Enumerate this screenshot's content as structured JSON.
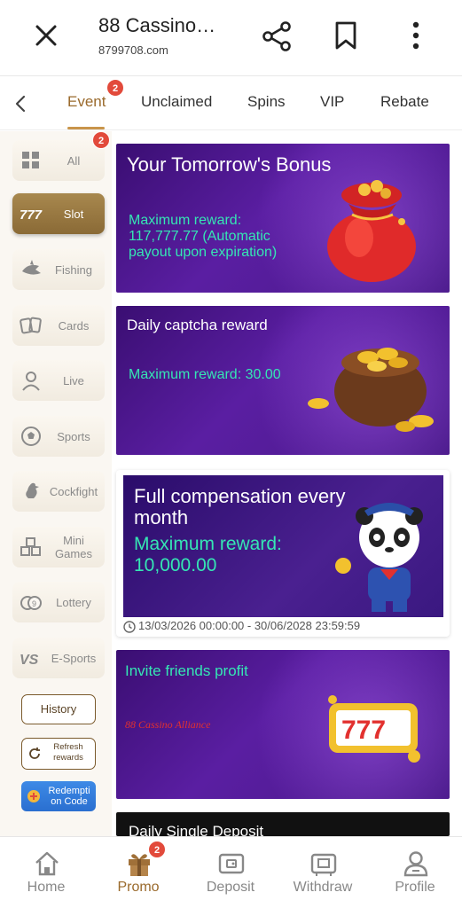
{
  "browser": {
    "title": "88 Cassino…",
    "url": "8799708.com"
  },
  "tabs": {
    "items": [
      {
        "label": "Event",
        "badge": "2"
      },
      {
        "label": "Unclaimed"
      },
      {
        "label": "Spins"
      },
      {
        "label": "VIP"
      },
      {
        "label": "Rebate"
      }
    ],
    "active": "Event"
  },
  "sidebar": {
    "items": [
      {
        "label": "All",
        "icon": "grid-icon",
        "badge": "2"
      },
      {
        "label": "Slot",
        "icon": "slot-777-icon"
      },
      {
        "label": "Fishing",
        "icon": "shark-icon"
      },
      {
        "label": "Cards",
        "icon": "playing-cards-icon"
      },
      {
        "label": "Live",
        "icon": "dealer-icon"
      },
      {
        "label": "Sports",
        "icon": "soccer-ball-icon"
      },
      {
        "label": "Cockfight",
        "icon": "rooster-icon"
      },
      {
        "label": "Mini Games",
        "icon": "cubes-icon"
      },
      {
        "label": "Lottery",
        "icon": "lottery-ball-icon"
      },
      {
        "label": "E-Sports",
        "icon": "vs-icon"
      }
    ],
    "active": "Slot",
    "history_label": "History",
    "refresh_label": "Refresh rewards",
    "redeem_label": "Redempti on Code"
  },
  "cards": [
    {
      "title": "Your Tomorrow's Bonus",
      "text": "Maximum reward: 117,777.77 (Automatic payout upon expiration)",
      "image": "red-money-bag-icon"
    },
    {
      "title": "Daily captcha reward",
      "text": "Maximum reward: 30.00",
      "image": "gold-coin-bag-icon"
    },
    {
      "title": "Full compensation every month",
      "subtitle": "Maximum reward:",
      "amount": "10,000.00",
      "image": "panda-mascot-icon",
      "date_range": "13/03/2026 00:00:00 - 30/06/2028 23:59:59"
    },
    {
      "title": "Invite friends profit",
      "text": "88 Cassino Alliance",
      "image": "slot-machine-777-icon"
    },
    {
      "title": "Daily Single Deposit"
    }
  ],
  "bottom_nav": {
    "items": [
      {
        "label": "Home",
        "icon": "home-icon"
      },
      {
        "label": "Promo",
        "icon": "gift-icon",
        "badge": "2"
      },
      {
        "label": "Deposit",
        "icon": "wallet-icon"
      },
      {
        "label": "Withdraw",
        "icon": "withdraw-icon"
      },
      {
        "label": "Profile",
        "icon": "profile-icon"
      }
    ],
    "active": "Promo"
  },
  "colors": {
    "accent": "#9a6a2c",
    "badge": "#e24a3b",
    "card_text": "#35e6b4"
  }
}
